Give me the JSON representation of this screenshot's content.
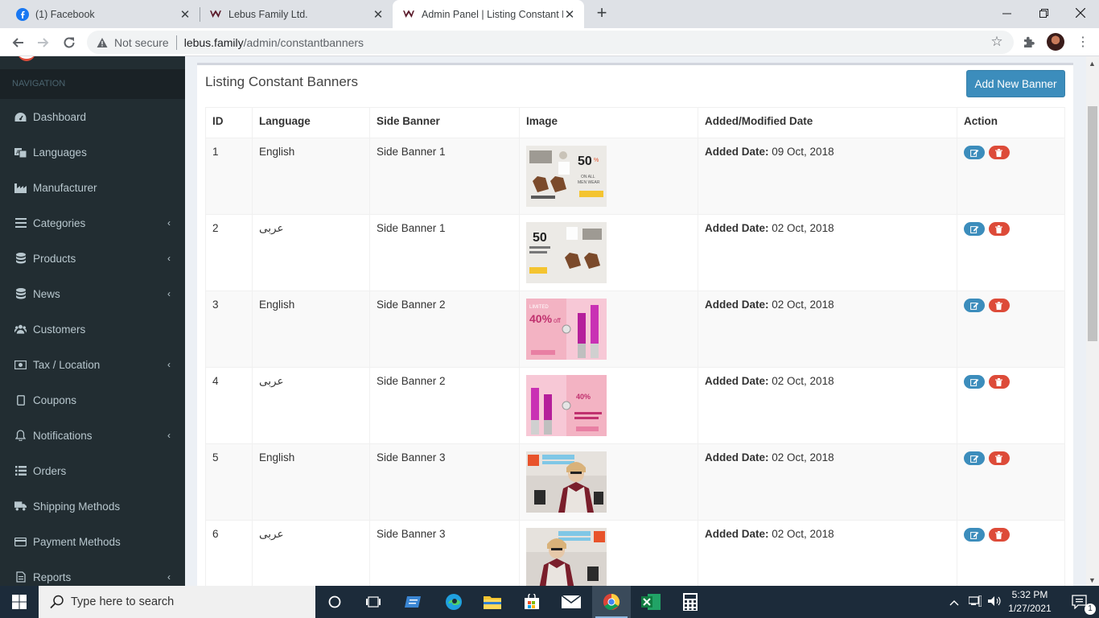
{
  "browser": {
    "tabs": [
      {
        "title": "(1) Facebook",
        "favicon": "facebook-icon",
        "active": false
      },
      {
        "title": "Lebus Family Ltd.",
        "favicon": "lebus-icon",
        "active": false
      },
      {
        "title": "Admin Panel | Listing Constant Banners",
        "favicon": "lebus-icon",
        "active": true
      }
    ],
    "security_label": "Not secure",
    "url_host": "lebus.family",
    "url_path": "/admin/constantbanners"
  },
  "sidebar": {
    "header": "NAVIGATION",
    "items": [
      {
        "label": "Dashboard",
        "icon": "dashboard-icon",
        "submenu": false
      },
      {
        "label": "Languages",
        "icon": "language-icon",
        "submenu": false
      },
      {
        "label": "Manufacturer",
        "icon": "industry-icon",
        "submenu": false
      },
      {
        "label": "Categories",
        "icon": "bars-icon",
        "submenu": true
      },
      {
        "label": "Products",
        "icon": "database-icon",
        "submenu": true
      },
      {
        "label": "News",
        "icon": "database-icon",
        "submenu": true
      },
      {
        "label": "Customers",
        "icon": "users-icon",
        "submenu": false
      },
      {
        "label": "Tax / Location",
        "icon": "money-icon",
        "submenu": true
      },
      {
        "label": "Coupons",
        "icon": "tablet-icon",
        "submenu": false
      },
      {
        "label": "Notifications",
        "icon": "bell-icon",
        "submenu": true
      },
      {
        "label": "Orders",
        "icon": "list-icon",
        "submenu": false
      },
      {
        "label": "Shipping Methods",
        "icon": "truck-icon",
        "submenu": false
      },
      {
        "label": "Payment Methods",
        "icon": "credit-card-icon",
        "submenu": false
      },
      {
        "label": "Reports",
        "icon": "file-icon",
        "submenu": true
      }
    ]
  },
  "main": {
    "title": "Listing Constant Banners",
    "add_button": "Add New Banner",
    "columns": [
      "ID",
      "Language",
      "Side Banner",
      "Image",
      "Added/Modified Date",
      "Action"
    ],
    "date_label": "Added Date:",
    "rows": [
      {
        "id": "1",
        "language": "English",
        "banner": "Side Banner 1",
        "date": "09 Oct, 2018",
        "image": "shoes"
      },
      {
        "id": "2",
        "language": "عربى",
        "banner": "Side Banner 1",
        "date": "02 Oct, 2018",
        "image": "shoes"
      },
      {
        "id": "3",
        "language": "English",
        "banner": "Side Banner 2",
        "date": "02 Oct, 2018",
        "image": "lipstick"
      },
      {
        "id": "4",
        "language": "عربى",
        "banner": "Side Banner 2",
        "date": "02 Oct, 2018",
        "image": "lipstick"
      },
      {
        "id": "5",
        "language": "English",
        "banner": "Side Banner 3",
        "date": "02 Oct, 2018",
        "image": "fashion"
      },
      {
        "id": "6",
        "language": "عربى",
        "banner": "Side Banner 3",
        "date": "02 Oct, 2018",
        "image": "fashion"
      }
    ]
  },
  "taskbar": {
    "search_placeholder": "Type here to search",
    "time": "5:32 PM",
    "date": "1/27/2021",
    "notification_count": "1"
  },
  "colors": {
    "sidebar_bg": "#222d32",
    "primary": "#3c8dbc",
    "danger": "#dd4b39"
  }
}
